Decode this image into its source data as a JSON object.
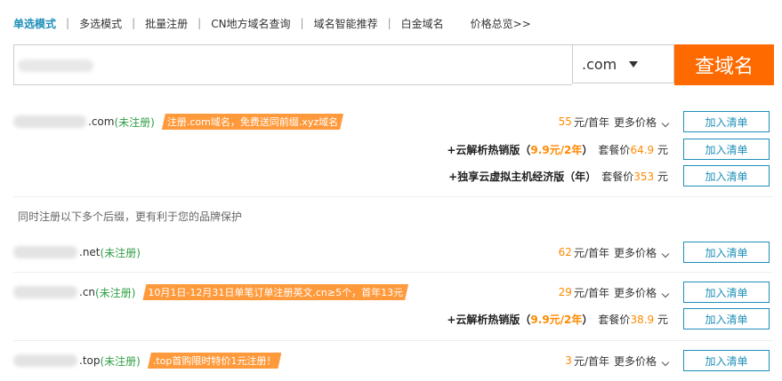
{
  "tabs": [
    "单选模式",
    "多选模式",
    "批量注册",
    "CN地方域名查询",
    "域名智能推荐",
    "白金域名",
    "价格总览>>"
  ],
  "search": {
    "suffix": ".com",
    "button": "查域名"
  },
  "hint": "同时注册以下多个后缀，更有利于您的品牌保护",
  "add_label": "加入清单",
  "domains": [
    {
      "tld": ".com",
      "status": "(未注册)",
      "promo": "注册.com域名，免费送同前缀.xyz域名",
      "price": "55",
      "unit": "元/首年",
      "more": "更多价格",
      "packages": [
        {
          "prefix": "+云解析热销版（",
          "deal": "9.9元/2年",
          "suffix": "）",
          "label": "套餐价",
          "price": "64.9",
          "unit": "元"
        },
        {
          "prefix": "+独享云虚拟主机经济版（年）",
          "deal": "",
          "suffix": "",
          "label": "套餐价",
          "price": "353",
          "unit": "元"
        }
      ]
    },
    {
      "tld": ".net",
      "status": "(未注册)",
      "promo": "",
      "price": "62",
      "unit": "元/首年",
      "more": "更多价格",
      "packages": []
    },
    {
      "tld": ".cn",
      "status": "(未注册)",
      "promo": "10月1日-12月31日单笔订单注册英文.cn≥5个，首年13元",
      "price": "29",
      "unit": "元/首年",
      "more": "更多价格",
      "packages": [
        {
          "prefix": "+云解析热销版（",
          "deal": "9.9元/2年",
          "suffix": "）",
          "label": "套餐价",
          "price": "38.9",
          "unit": "元"
        }
      ]
    },
    {
      "tld": ".top",
      "status": "(未注册)",
      "promo": ".top首购限时特价1元注册！",
      "price": "3",
      "unit": "元/首年",
      "more": "更多价格",
      "packages": []
    }
  ]
}
